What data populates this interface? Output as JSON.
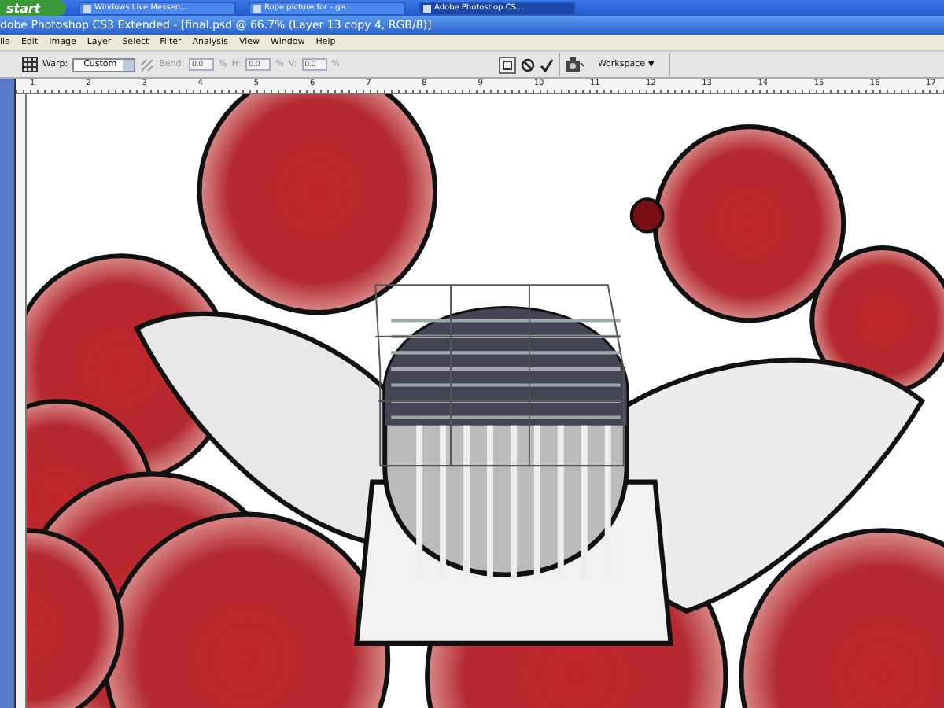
{
  "taskbar": {
    "start": "start",
    "tasks": [
      {
        "label": "Windows Live Messen...",
        "selected": false
      },
      {
        "label": "Rope picture for - ge...",
        "selected": false
      },
      {
        "label": "Adobe Photoshop CS...",
        "selected": true
      }
    ]
  },
  "window": {
    "title": "dobe Photoshop CS3 Extended - [final.psd @ 66.7% (Layer 13 copy 4, RGB/8)]"
  },
  "menu": [
    "ile",
    "Edit",
    "Image",
    "Layer",
    "Select",
    "Filter",
    "Analysis",
    "View",
    "Window",
    "Help"
  ],
  "options": {
    "warp_label": "Warp:",
    "warp_value": "Custom",
    "fields": [
      {
        "label": "Bend:",
        "value": "0.0",
        "unit": "%",
        "disabled": true
      },
      {
        "label": "H:",
        "value": "0.0",
        "unit": "%",
        "disabled": true
      },
      {
        "label": "V:",
        "value": "0.0",
        "unit": "%",
        "disabled": true
      }
    ],
    "workspace": "Workspace ▼"
  },
  "ruler": [
    "1",
    "2",
    "3",
    "4",
    "5",
    "6",
    "7",
    "8",
    "9",
    "10",
    "11",
    "12",
    "13",
    "14",
    "15",
    "16",
    "17"
  ]
}
